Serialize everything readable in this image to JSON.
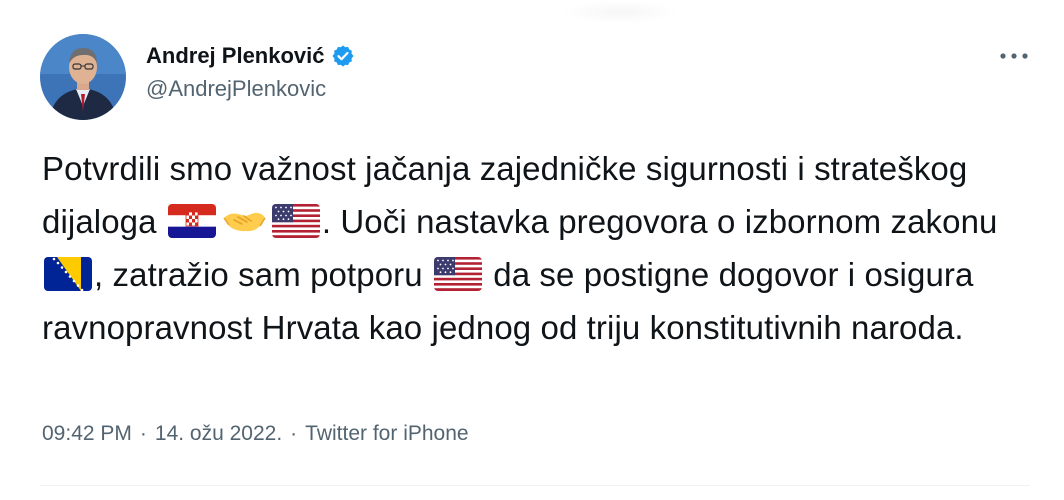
{
  "author": {
    "display_name": "Andrej Plenković",
    "handle": "@AndrejPlenkovic",
    "verified": true,
    "avatar_icon": "profile-photo"
  },
  "tweet": {
    "text_parts": [
      "Potvrdili smo važnost jačanja zajedničke sigurnosti i strateškog dijaloga",
      ". Uoči nastavka pregovora o izbornom zakonu",
      ", zatražio sam potporu",
      "da se postigne dogovor i osigura ravnopravnost Hrvata kao jednog od triju konstitutivnih naroda."
    ],
    "emojis": [
      "croatia-flag",
      "handshake",
      "usa-flag",
      "bosnia-herzegovina-flag",
      "usa-flag"
    ]
  },
  "meta": {
    "time": "09:42 PM",
    "date": "14. ožu 2022.",
    "source": "Twitter for iPhone",
    "separator": "·"
  },
  "colors": {
    "text": "#0f1419",
    "secondary": "#536471",
    "verified": "#1d9bf0",
    "divider": "#eff3f4"
  }
}
